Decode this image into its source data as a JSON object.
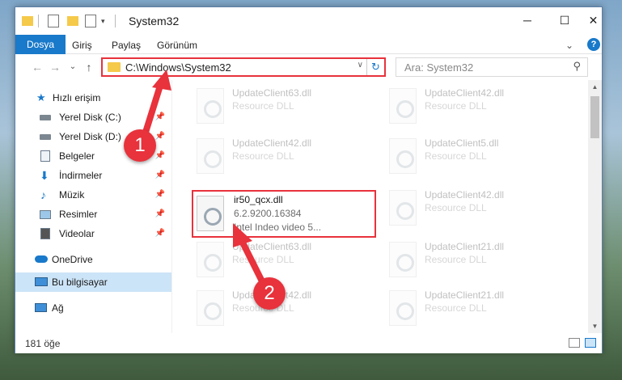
{
  "window": {
    "title": "System32",
    "minimize_glyph": "─",
    "maximize_glyph": "☐",
    "close_glyph": "✕"
  },
  "ribbon": {
    "tabs": [
      "Dosya",
      "Giriş",
      "Paylaş",
      "Görünüm"
    ],
    "expand_glyph": "⌄",
    "help_glyph": "?"
  },
  "nav": {
    "back_glyph": "←",
    "forward_glyph": "→",
    "recent_glyph": "⌄",
    "up_glyph": "↑",
    "address_path": "C:\\Windows\\System32",
    "address_dropdown_glyph": "∨",
    "refresh_glyph": "↻",
    "search_placeholder": "Ara: System32",
    "search_glyph": "⚲"
  },
  "sidebar": {
    "items": [
      {
        "label": "Hızlı erişim",
        "icon": "star-icon",
        "pinned": false
      },
      {
        "label": "Yerel Disk (C:)",
        "icon": "drive-icon",
        "pinned": true
      },
      {
        "label": "Yerel Disk (D:)",
        "icon": "drive-icon",
        "pinned": true
      },
      {
        "label": "Belgeler",
        "icon": "documents-icon",
        "pinned": true
      },
      {
        "label": "İndirmeler",
        "icon": "download-icon",
        "pinned": true
      },
      {
        "label": "Müzik",
        "icon": "music-icon",
        "pinned": true
      },
      {
        "label": "Resimler",
        "icon": "pictures-icon",
        "pinned": true
      },
      {
        "label": "Videolar",
        "icon": "videos-icon",
        "pinned": true
      },
      {
        "label": "OneDrive",
        "icon": "cloud-icon",
        "pinned": false
      },
      {
        "label": "Bu bilgisayar",
        "icon": "computer-icon",
        "pinned": false,
        "selected": true
      },
      {
        "label": "Ağ",
        "icon": "network-icon",
        "pinned": false
      }
    ],
    "pin_glyph": "📌"
  },
  "files": {
    "left": [
      {
        "name": "UpdateClient63.dll",
        "sub": "Resource DLL"
      },
      {
        "name": "UpdateClient42.dll",
        "sub": "Resource DLL"
      },
      {
        "name": "ir50_qcx.dll",
        "version": "6.2.9200.16384",
        "description": "Intel Indeo video 5..."
      },
      {
        "name": "UpdateClient63.dll",
        "sub": "Resource DLL"
      },
      {
        "name": "UpdateClient42.dll",
        "sub": "Resource DLL"
      }
    ],
    "right": [
      {
        "name": "UpdateClient42.dll",
        "sub": "Resource DLL"
      },
      {
        "name": "UpdateClient5.dll",
        "sub": "Resource DLL"
      },
      {
        "name": "UpdateClient42.dll",
        "sub": "Resource DLL"
      },
      {
        "name": "UpdateClient21.dll",
        "sub": "Resource DLL"
      },
      {
        "name": "UpdateClient21.dll",
        "sub": "Resource DLL"
      }
    ]
  },
  "status": {
    "item_count": "181 öğe"
  },
  "callouts": {
    "first": "1",
    "second": "2"
  },
  "colors": {
    "accent": "#1979ca",
    "highlight_red": "#e8323c",
    "selected_bg": "#cce4f7"
  }
}
